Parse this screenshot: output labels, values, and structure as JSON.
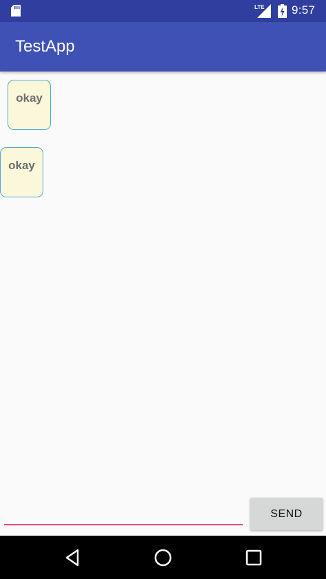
{
  "status_bar": {
    "time": "9:57",
    "network_label": "LTE",
    "icons": [
      "sd-card-icon",
      "lte-signal-icon",
      "battery-charging-icon"
    ]
  },
  "app_bar": {
    "title": "TestApp"
  },
  "messages": [
    {
      "text": "okay"
    },
    {
      "text": "okay"
    }
  ],
  "composer": {
    "input_value": "",
    "send_label": "SEND"
  },
  "nav_bar": {
    "icons": [
      "back-icon",
      "home-icon",
      "recents-icon"
    ]
  },
  "colors": {
    "status_bar": "#303F9F",
    "app_bar": "#3F51B5",
    "bubble_fill": "#FAF7DA",
    "bubble_border": "#4FA6D6",
    "input_underline": "#E64A7A",
    "button_bg": "#D6D7D7"
  }
}
